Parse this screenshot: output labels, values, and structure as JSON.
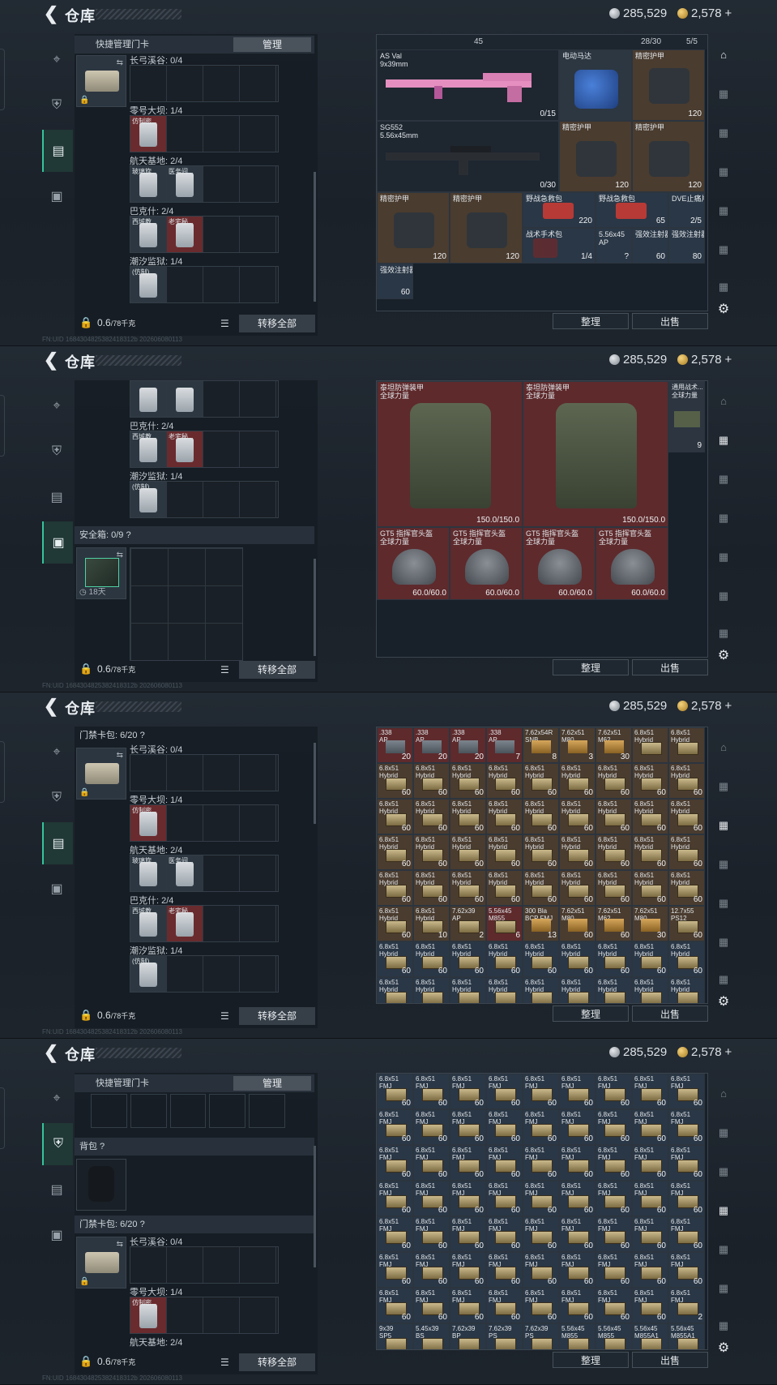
{
  "header": {
    "title": "仓库",
    "silver": "285,529",
    "gold": "2,578",
    "plus": "+"
  },
  "nav": {
    "tabs": [
      "weapon",
      "armor",
      "keycard",
      "safebox"
    ]
  },
  "quick_manage": {
    "label": "快捷管理门卡",
    "button": "管理"
  },
  "keycard_bag": {
    "label": "门禁卡包: 6/20 ?"
  },
  "backpack": {
    "label": "背包 ?"
  },
  "safebox": {
    "label": "安全箱: 0/9 ?",
    "timer": "18天"
  },
  "maps": [
    {
      "label": "长弓溪谷: 0/4"
    },
    {
      "label": "零号大坝: 1/4"
    },
    {
      "label": "航天基地: 2/4"
    },
    {
      "label": "巴克什: 2/4"
    },
    {
      "label": "潮汐监狱: 1/4"
    }
  ],
  "keycards": {
    "a": "仿制密...",
    "b": "玻璃旋...",
    "c": "医务间...",
    "d": "西城教...",
    "e": "老宅秘...",
    "f": "(仿制)..."
  },
  "bottom": {
    "weight": "0.6",
    "weight_unit": "/78千克",
    "transfer": "转移全部",
    "sort": "整理",
    "sell": "出售"
  },
  "panel1": {
    "top_count_left": "45",
    "top_count_a": "28/30",
    "top_count_b": "5/5",
    "items": {
      "asval": {
        "name": "AS Val\n9x39mm",
        "count": "0/15"
      },
      "motor": {
        "name": "电动马达"
      },
      "rig1": {
        "name": "精密护甲",
        "count": "120"
      },
      "sg552": {
        "name": "SG552\n5.56x45mm",
        "count": "0/30"
      },
      "rig2": {
        "name": "精密护甲",
        "count": "120"
      },
      "rig3": {
        "name": "精密护甲",
        "count": "120"
      },
      "rig4": {
        "name": "精密护甲",
        "count": "120"
      },
      "rig5": {
        "name": "精密护甲",
        "count": "120"
      },
      "med1": {
        "name": "野战急救包",
        "count": "220"
      },
      "med2": {
        "name": "野战急救包",
        "count": "65"
      },
      "dve": {
        "name": "DVE止痛片",
        "count": "2/5"
      },
      "surg": {
        "name": "战术手术包",
        "count": "1/4"
      },
      "ammo": {
        "name": "5.56x45\nAP",
        "count": "?"
      },
      "inj1": {
        "name": "强效注射器",
        "count": "60"
      },
      "inj2": {
        "name": "强效注射器",
        "count": "80"
      },
      "inj3": {
        "name": "强效注射器",
        "count": "60"
      }
    }
  },
  "panel2": {
    "armor1": {
      "name": "泰坦防弹装甲\n全球力量",
      "count": "150.0/150.0"
    },
    "armor2": {
      "name": "泰坦防弹装甲\n全球力量",
      "count": "150.0/150.0"
    },
    "tactical": {
      "name": "通用战术...\n全球力量",
      "count": "9"
    },
    "helmet1": {
      "name": "GT5 指挥官头盔\n全球力量",
      "count": "60.0/60.0"
    },
    "helmet2": {
      "name": "GT5 指挥官头盔\n全球力量",
      "count": "60.0/60.0"
    },
    "helmet3": {
      "name": "GT5 指挥官头盔\n全球力量",
      "count": "60.0/60.0"
    },
    "helmet4": {
      "name": "GT5 指挥官头盔\n全球力量",
      "count": "60.0/60.0"
    }
  },
  "panel3": {
    "row1": [
      {
        "name": ".338\nAP",
        "count": "20"
      },
      {
        "name": ".338\nAP",
        "count": "20"
      },
      {
        "name": ".338\nAP",
        "count": "20"
      },
      {
        "name": ".338\nAP",
        "count": "7"
      },
      {
        "name": "7.62x54R\nSNB",
        "count": "8"
      },
      {
        "name": "7.62x51\nM80",
        "count": "3"
      },
      {
        "name": "7.62x51\nM62",
        "count": "30"
      },
      {
        "name": "6.8x51\nHybrid",
        "count": ""
      },
      {
        "name": "6.8x51\nHybrid",
        "count": ""
      }
    ],
    "common": {
      "name": "6.8x51\nHybrid",
      "count": "60"
    },
    "row6": [
      {
        "name": "6.8x51\nHybrid",
        "count": "60"
      },
      {
        "name": "6.8x51\nHybrid",
        "count": "10"
      },
      {
        "name": "7.62x39\nAP",
        "count": "2"
      },
      {
        "name": "5.56x45\nM855",
        "count": "6"
      },
      {
        "name": "300 Bla\nBCP FMJ",
        "count": "13"
      },
      {
        "name": "7.62x51\nM80",
        "count": "60"
      },
      {
        "name": "7.62x51\nM62",
        "count": "60"
      },
      {
        "name": "7.62x51\nM80",
        "count": "30"
      },
      {
        "name": "12.7x55\nPS12",
        "count": "60"
      }
    ]
  },
  "panel4": {
    "common": {
      "name": "6.8x51\nFMJ",
      "count": "60"
    },
    "last_count": "2",
    "bottom_row": [
      {
        "name": "9x39\nSP5"
      },
      {
        "name": "5.45x39\nBS"
      },
      {
        "name": "7.62x39\nBP"
      },
      {
        "name": "7.62x39\nPS"
      },
      {
        "name": "7.62x39\nPS"
      },
      {
        "name": "5.56x45\nM855"
      },
      {
        "name": "5.56x45\nM855"
      },
      {
        "name": "5.56x45\nM855A1"
      },
      {
        "name": "5.56x45\nM855A1"
      }
    ]
  },
  "footer": {
    "text": "FN:UID 1684304825382418312b 202606080113"
  }
}
